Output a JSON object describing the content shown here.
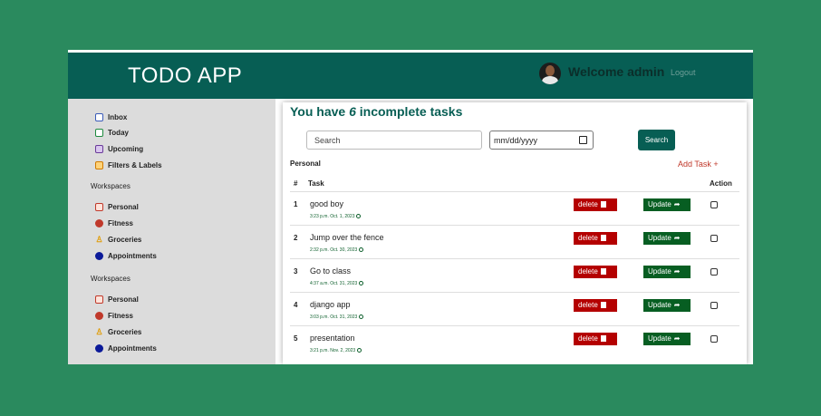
{
  "header": {
    "brand": "TODO APP",
    "welcome": "Welcome admin",
    "logout": "Logout"
  },
  "sidebar": {
    "items": [
      {
        "label": "Inbox",
        "icon": "inbox-icon"
      },
      {
        "label": "Today",
        "icon": "calendar-today-icon"
      },
      {
        "label": "Upcoming",
        "icon": "calendar-upcoming-icon"
      },
      {
        "label": "Filters & Labels",
        "icon": "filters-labels-icon"
      }
    ],
    "workspace_groups": [
      {
        "title": "Workspaces",
        "items": [
          {
            "label": "Personal",
            "icon": "personal-icon"
          },
          {
            "label": "Fitness",
            "icon": "fitness-dot-icon"
          },
          {
            "label": "Groceries",
            "icon": "groceries-icon"
          },
          {
            "label": "Appointments",
            "icon": "appointments-dot-icon"
          }
        ]
      },
      {
        "title": "Workspaces",
        "items": [
          {
            "label": "Personal",
            "icon": "personal-icon"
          },
          {
            "label": "Fitness",
            "icon": "fitness-dot-icon"
          },
          {
            "label": "Groceries",
            "icon": "groceries-icon"
          },
          {
            "label": "Appointments",
            "icon": "appointments-dot-icon"
          }
        ]
      }
    ]
  },
  "main": {
    "heading_prefix": "You have ",
    "incomplete_count": "6",
    "heading_suffix": " incomplete tasks",
    "search_placeholder": "Search",
    "date_placeholder": "mm/dd/yyyy",
    "search_button": "Search",
    "group_name": "Personal",
    "add_task": "Add Task +",
    "table_headers": {
      "num": "#",
      "task": "Task",
      "action": "Action"
    },
    "delete_label": "delete",
    "update_label": "Update",
    "tasks": [
      {
        "num": "1",
        "title": "good boy",
        "time": "3:23 p.m. Oct. 1, 2023"
      },
      {
        "num": "2",
        "title": "Jump over the fence",
        "time": "2:32 p.m. Oct. 30, 2023"
      },
      {
        "num": "3",
        "title": "Go to class",
        "time": "4:37 a.m. Oct. 31, 2023"
      },
      {
        "num": "4",
        "title": "django app",
        "time": "3:03 p.m. Oct. 31, 2023"
      },
      {
        "num": "5",
        "title": "presentation",
        "time": "3:21 p.m. Nov. 2, 2023"
      }
    ]
  },
  "colors": {
    "background": "#2a8a5e",
    "header": "#075e54",
    "delete": "#b40000",
    "update": "#075e22"
  }
}
